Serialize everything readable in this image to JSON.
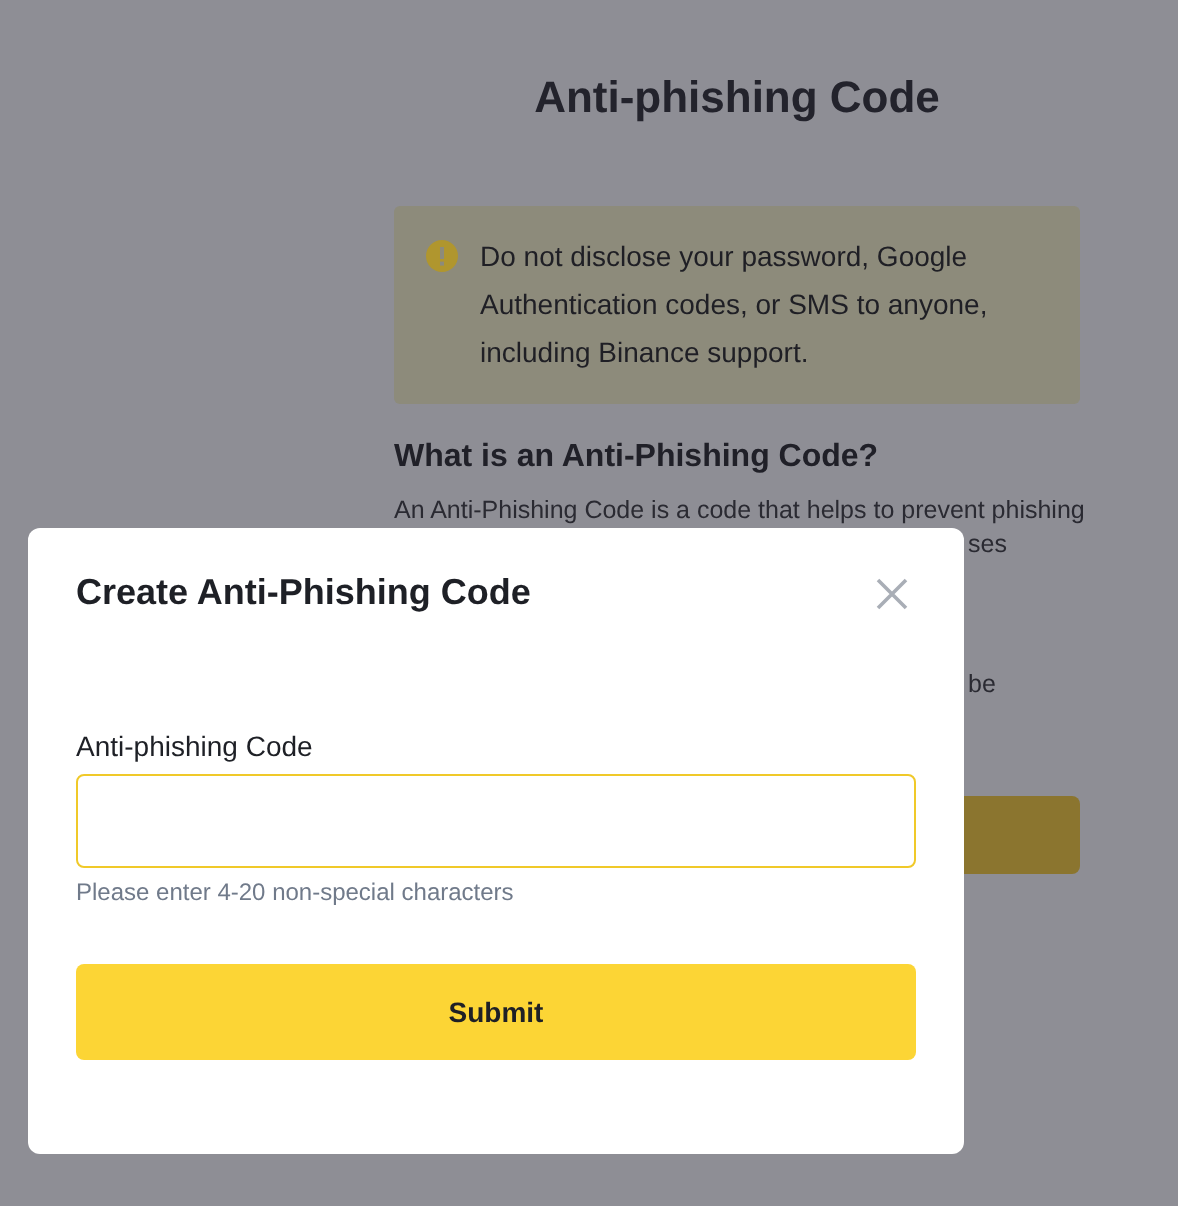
{
  "page": {
    "title": "Anti-phishing Code",
    "notice": "Do not disclose your password, Google Authentication codes, or SMS to anyone, including Binance support.",
    "heading": "What is an Anti-Phishing Code?",
    "paragraph_lines": [
      "An Anti-Phishing Code is a code that helps to prevent phishing",
      "ses",
      "be"
    ]
  },
  "dialog": {
    "title": "Create Anti-Phishing Code",
    "field": {
      "label": "Anti-phishing Code",
      "hint": "Please enter 4-20 non-special characters"
    },
    "submit": "Submit"
  }
}
